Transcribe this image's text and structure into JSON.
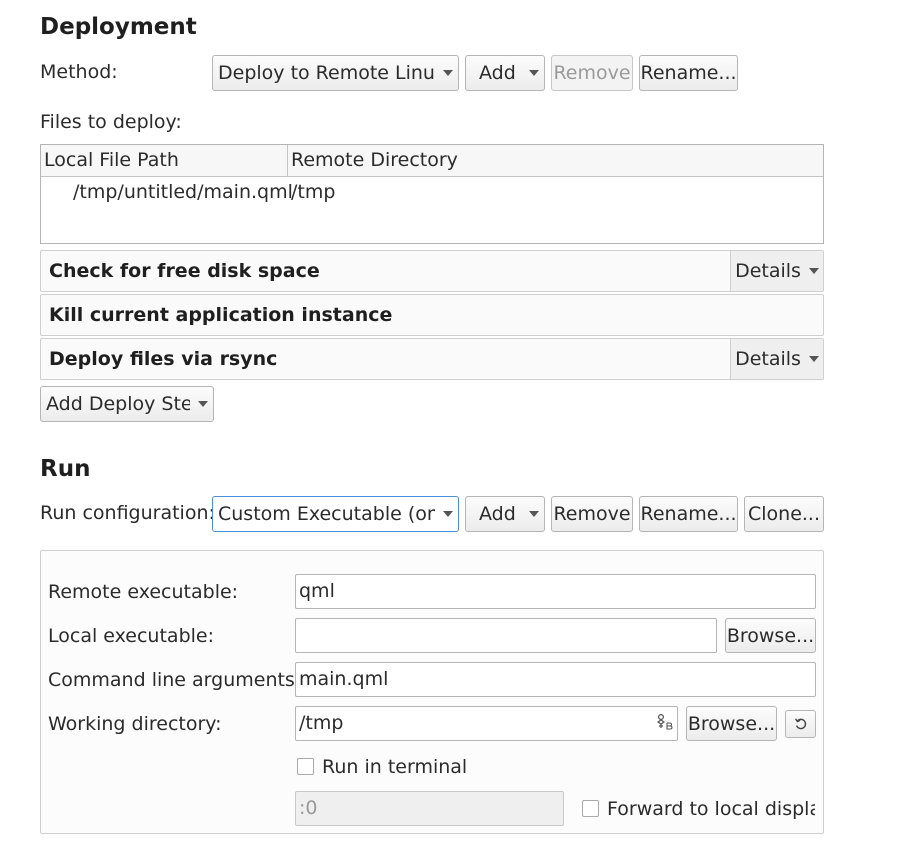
{
  "deployment": {
    "title": "Deployment",
    "method_label": "Method:",
    "method_value": "Deploy to Remote Linux",
    "add_label": "Add",
    "remove_label": "Remove",
    "rename_label": "Rename...",
    "files_label": "Files to deploy:",
    "table": {
      "columns": [
        "Local File Path",
        "Remote Directory"
      ],
      "rows": [
        {
          "local": "/tmp/untitled/main.qml",
          "remote": "/tmp"
        }
      ]
    },
    "steps": [
      {
        "name": "Check for free disk space",
        "details": "Details"
      },
      {
        "name": "Kill current application instance"
      },
      {
        "name": "Deploy files via rsync",
        "details": "Details"
      }
    ],
    "add_step_label": "Add Deploy Step"
  },
  "run": {
    "title": "Run",
    "config_label": "Run configuration:",
    "config_value": "Custom Executable (on Generic Linux Device)",
    "add_label": "Add",
    "remove_label": "Remove",
    "rename_label": "Rename...",
    "clone_label": "Clone...",
    "remote_exec_label": "Remote executable:",
    "remote_exec_value": "qml",
    "local_exec_label": "Local executable:",
    "local_exec_value": "",
    "browse_label": "Browse...",
    "args_label": "Command line arguments:",
    "args_value": "main.qml",
    "workdir_label": "Working directory:",
    "workdir_value": "/tmp",
    "workdir_browse_label": "Browse...",
    "run_in_terminal_label": "Run in terminal",
    "display_value": ":0",
    "forward_display_label": "Forward to local display"
  }
}
